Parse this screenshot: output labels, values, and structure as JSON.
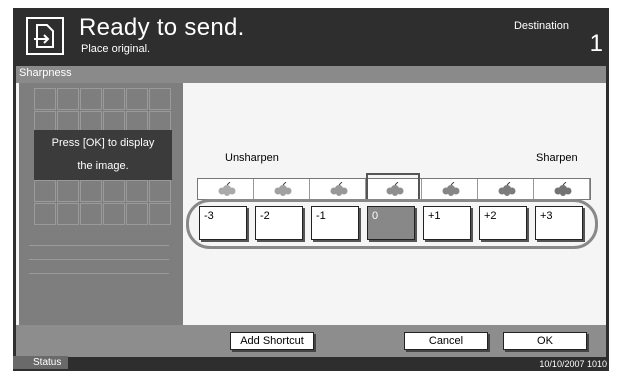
{
  "header": {
    "title": "Ready to send.",
    "subtitle": "Place original.",
    "destination_label": "Destination",
    "destination_count": "1"
  },
  "section": {
    "label": "Sharpness"
  },
  "preview": {
    "message_line1": "Press [OK] to display",
    "message_line2": "the image."
  },
  "scale": {
    "left_label": "Unsharpen",
    "right_label": "Sharpen",
    "levels": [
      "-3",
      "-2",
      "-1",
      "0",
      "+1",
      "+2",
      "+3"
    ],
    "selected": "0"
  },
  "footer": {
    "add_shortcut": "Add Shortcut",
    "cancel": "Cancel",
    "ok": "OK"
  },
  "status": {
    "button": "Status",
    "datetime": "10/10/2007   1010"
  },
  "colors": {
    "panel": "#2e2e2e",
    "section_bar": "#8a8a8a",
    "selected": "#888888"
  }
}
